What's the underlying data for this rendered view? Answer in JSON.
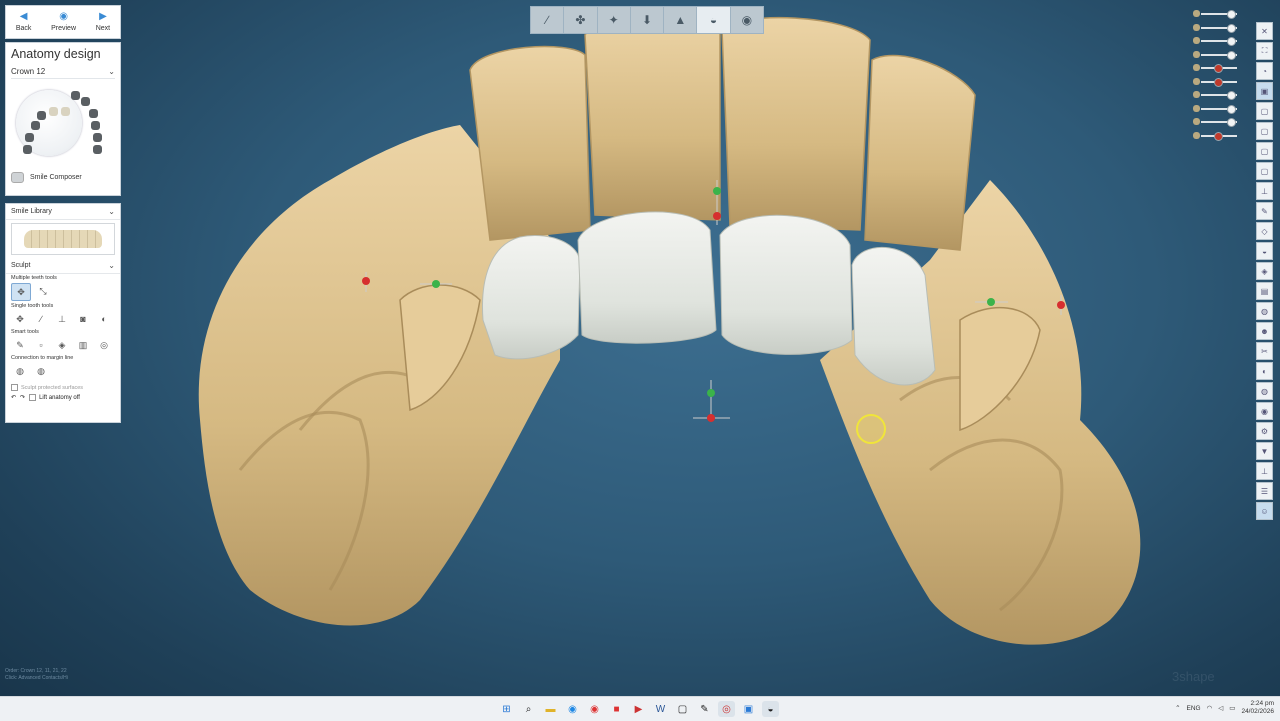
{
  "navigation": {
    "back": "Back",
    "preview": "Preview",
    "next": "Next"
  },
  "anatomy": {
    "title": "Anatomy design",
    "crown": "Crown 12",
    "smile_composer": "Smile Composer"
  },
  "smile_library": {
    "header": "Smile Library"
  },
  "sculpt": {
    "header": "Sculpt",
    "multiple_teeth_tools": "Multiple teeth tools",
    "single_tooth_tools": "Single tooth tools",
    "smart_tools": "Smart tools",
    "connection_to_margin_line": "Connection to margin line",
    "sculpt_protected": "Sculpt protected surfaces",
    "lift_anatomy_off": "Lift anatomy off"
  },
  "status": {
    "line1": "Order: Crown 12, 11, 21, 22",
    "line2": "Click: Advanced Contacts/Hi"
  },
  "brand": "3shape",
  "taskbar": {
    "lang": "ENG",
    "time": "2:24 pm",
    "date": "24/02/2026"
  },
  "toolbar": {
    "steps": [
      "scan-icon",
      "prep-icon",
      "margin-icon",
      "insertion-icon",
      "gingiva-icon",
      "anatomy-icon",
      "export-icon"
    ],
    "active_step": 5
  },
  "view": {
    "sliders": [
      0.9,
      0.9,
      0.9,
      0.9,
      0.45,
      0.45,
      0.9,
      0.9,
      0.9,
      0.45
    ]
  },
  "colors": {
    "accent": "#3a8bd4",
    "cursor": "#f0e53a",
    "gypsum": "#e2c99a",
    "crown": "#e8ebe6"
  }
}
